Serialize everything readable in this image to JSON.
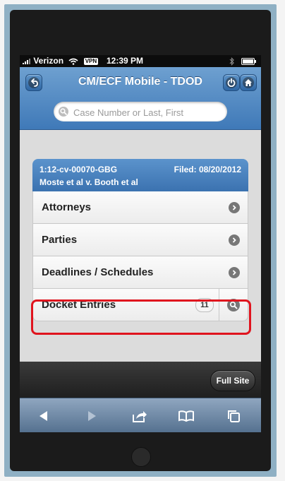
{
  "status_bar": {
    "carrier": "Verizon",
    "vpn": "VPN",
    "time": "12:39 PM"
  },
  "header": {
    "title": "CM/ECF Mobile - TDOD"
  },
  "search": {
    "placeholder": "Case Number or Last, First"
  },
  "case": {
    "number": "1:12-cv-00070-GBG",
    "filed": "Filed: 08/20/2012",
    "name": "Moste et al v. Booth et al"
  },
  "menu": {
    "attorneys": "Attorneys",
    "parties": "Parties",
    "deadlines": "Deadlines / Schedules",
    "docket": "Docket Entries",
    "docket_count": "11"
  },
  "footer": {
    "full_site": "Full Site"
  },
  "colors": {
    "header_blue": "#4a82c0",
    "highlight_red": "#e0141e"
  }
}
